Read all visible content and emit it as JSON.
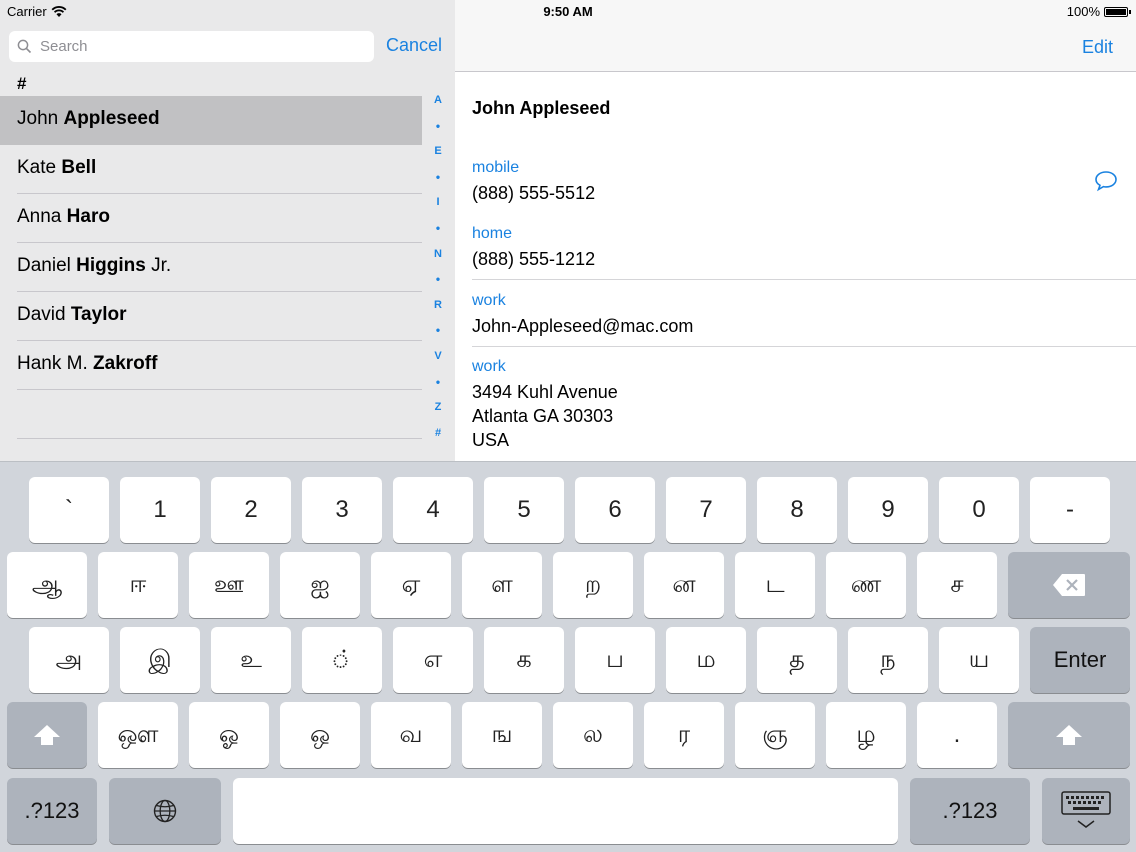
{
  "status_bar": {
    "carrier": "Carrier",
    "time": "9:50 AM",
    "battery": "100%"
  },
  "search": {
    "placeholder": "Search",
    "cancel_label": "Cancel"
  },
  "section_header": "#",
  "contacts": [
    {
      "first": "John ",
      "last": "Appleseed",
      "suffix": "",
      "selected": true
    },
    {
      "first": "Kate ",
      "last": "Bell",
      "suffix": "",
      "selected": false
    },
    {
      "first": "Anna ",
      "last": "Haro",
      "suffix": "",
      "selected": false
    },
    {
      "first": "Daniel ",
      "last": "Higgins",
      "suffix": " Jr.",
      "selected": false
    },
    {
      "first": "David ",
      "last": "Taylor",
      "suffix": "",
      "selected": false
    },
    {
      "first": "Hank M. ",
      "last": "Zakroff",
      "suffix": "",
      "selected": false
    }
  ],
  "index_letters": [
    "A",
    "•",
    "E",
    "•",
    "I",
    "•",
    "N",
    "•",
    "R",
    "•",
    "V",
    "•",
    "Z",
    "#"
  ],
  "detail": {
    "edit_label": "Edit",
    "name": "John Appleseed",
    "fields": [
      {
        "label": "mobile",
        "value": "(888) 555-5512"
      },
      {
        "label": "home",
        "value": "(888) 555-1212"
      },
      {
        "label": "work",
        "value": "John-Appleseed@mac.com"
      },
      {
        "label": "work",
        "value": "3494 Kuhl Avenue\nAtlanta GA 30303\nUSA"
      }
    ],
    "message_icon": "message-bubble-icon"
  },
  "keyboard": {
    "row1": [
      "`",
      "1",
      "2",
      "3",
      "4",
      "5",
      "6",
      "7",
      "8",
      "9",
      "0",
      "-"
    ],
    "row2": [
      "ஆ",
      "ஈ",
      "ஊ",
      "ஐ",
      "ஏ",
      "ள",
      "ற",
      "ன",
      "ட",
      "ண",
      "ச"
    ],
    "row3": [
      "அ",
      "இ",
      "உ",
      "்",
      "எ",
      "க",
      "ப",
      "ம",
      "த",
      "ந",
      "ய"
    ],
    "row4": [
      "ஔ",
      "ஓ",
      "ஒ",
      "வ",
      "ங",
      "ல",
      "ர",
      "ஞ",
      "ழ",
      "."
    ],
    "enter_label": "Enter",
    "numbers_label": ".?123",
    "icons": {
      "backspace": "backspace-icon",
      "shift": "shift-icon",
      "globe": "globe-icon",
      "dismiss": "keyboard-dismiss-icon"
    },
    "accent_color": "#1a82e0"
  }
}
